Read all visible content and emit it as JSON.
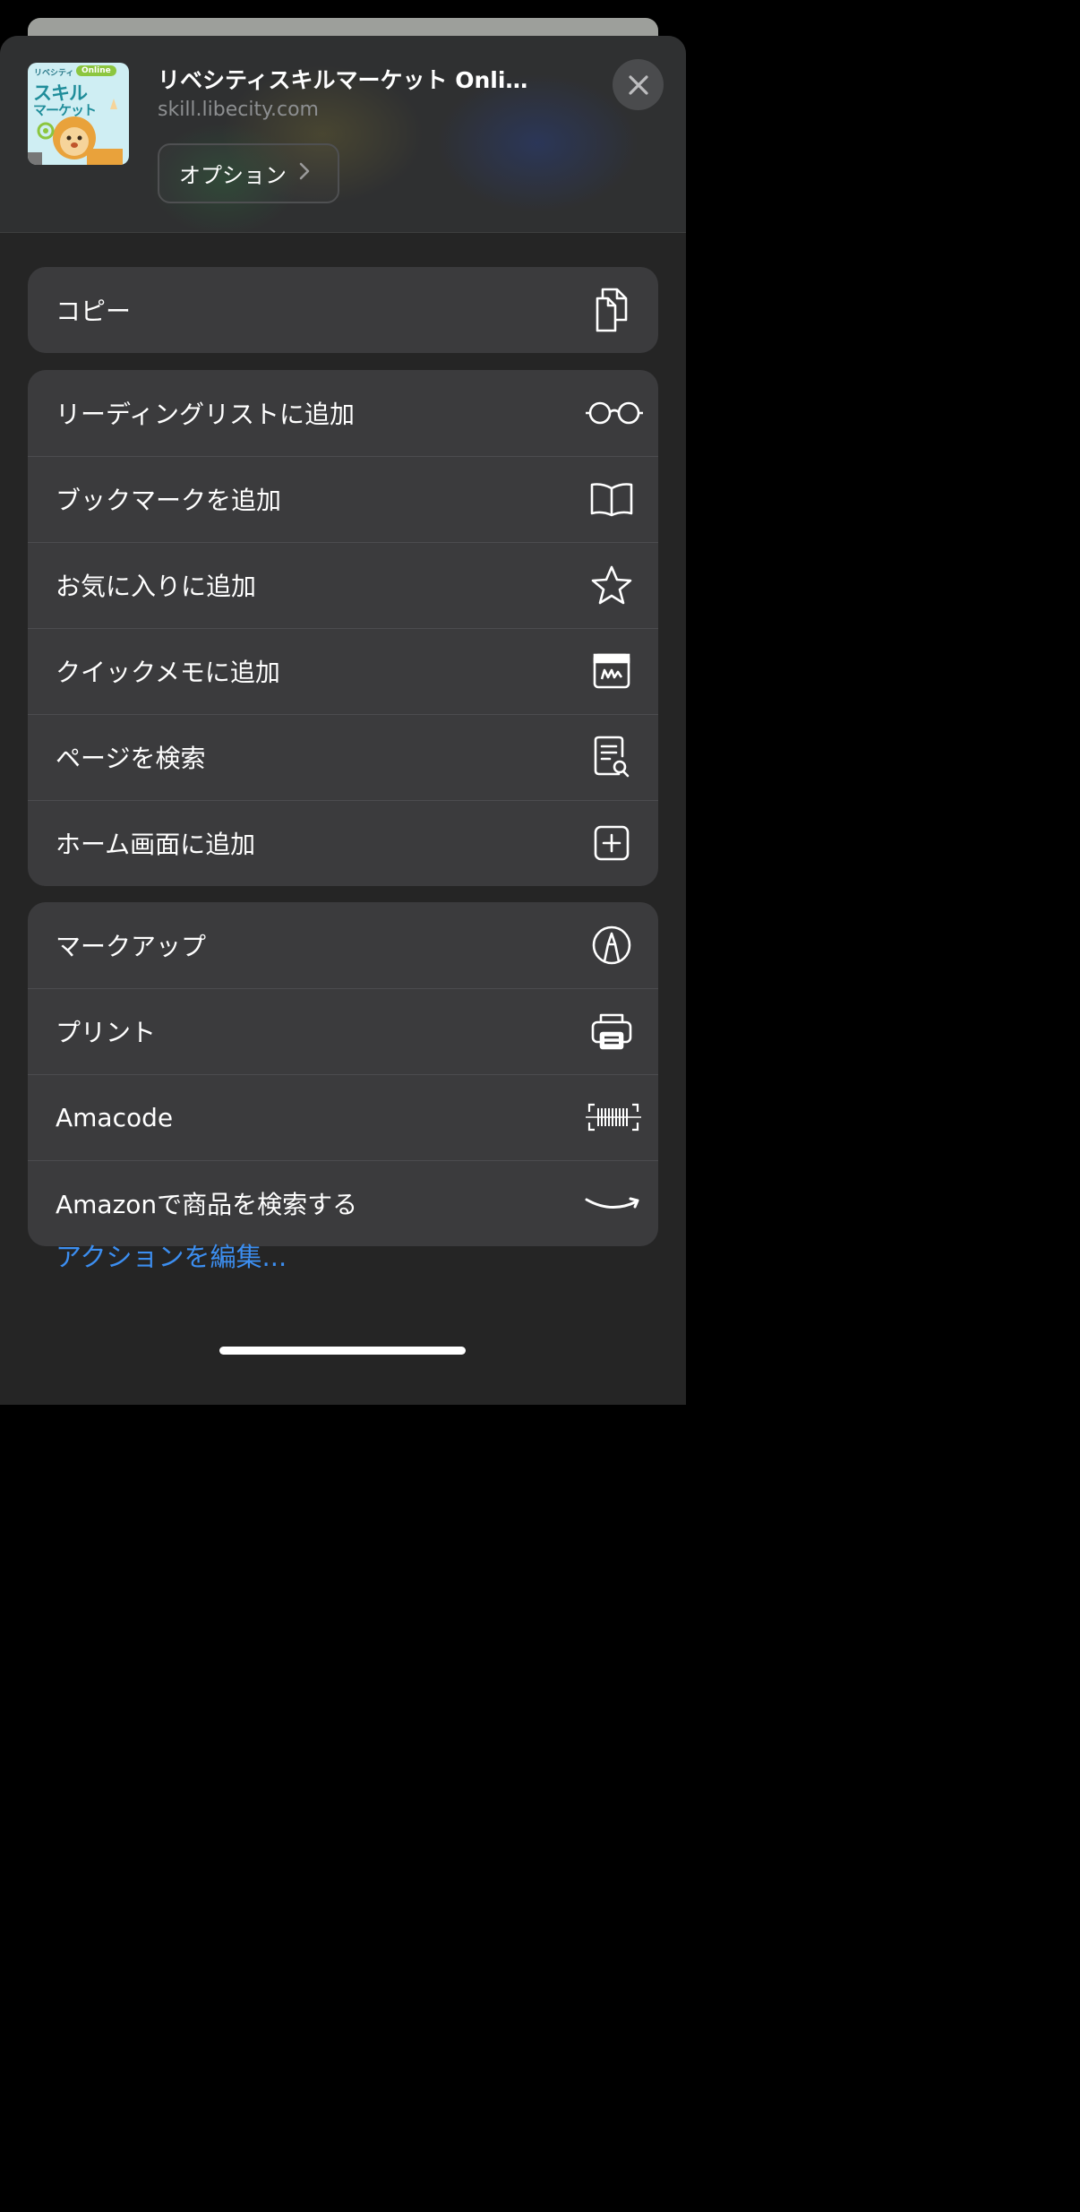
{
  "header": {
    "title": "リベシティスキルマーケット Onli…",
    "url": "skill.libecity.com",
    "options_label": "オプション",
    "thumbnail": {
      "brand": "リベシティ",
      "badge": "Online",
      "line1": "スキル",
      "line2": "マーケット"
    }
  },
  "groups": [
    {
      "items": [
        {
          "label": "コピー",
          "icon": "copy-icon"
        }
      ]
    },
    {
      "items": [
        {
          "label": "リーディングリストに追加",
          "icon": "glasses-icon"
        },
        {
          "label": "ブックマークを追加",
          "icon": "book-icon"
        },
        {
          "label": "お気に入りに追加",
          "icon": "star-icon"
        },
        {
          "label": "クイックメモに追加",
          "icon": "quick-note-icon"
        },
        {
          "label": "ページを検索",
          "icon": "find-in-page-icon"
        },
        {
          "label": "ホーム画面に追加",
          "icon": "plus-square-icon"
        }
      ]
    },
    {
      "items": [
        {
          "label": "マークアップ",
          "icon": "markup-icon"
        },
        {
          "label": "プリント",
          "icon": "printer-icon"
        },
        {
          "label": "Amacode",
          "icon": "barcode-icon"
        },
        {
          "label": "Amazonで商品を検索する",
          "icon": "amazon-smile-icon"
        }
      ]
    }
  ],
  "edit_actions_label": "アクションを編集..."
}
